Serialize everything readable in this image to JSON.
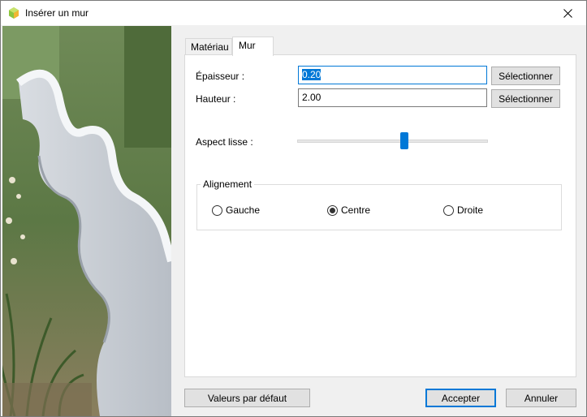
{
  "window": {
    "title": "Insérer un mur"
  },
  "tabs": [
    {
      "label": "Matériau"
    },
    {
      "label": "Mur"
    }
  ],
  "fields": {
    "epaisseur": {
      "label": "Épaisseur :",
      "value": "0.20",
      "button": "Sélectionner"
    },
    "hauteur": {
      "label": "Hauteur :",
      "value": "2.00",
      "button": "Sélectionner"
    }
  },
  "slider": {
    "label": "Aspect lisse :",
    "value_fraction": 0.56
  },
  "alignment": {
    "legend": "Alignement",
    "options": [
      {
        "label": "Gauche",
        "checked": false
      },
      {
        "label": "Centre",
        "checked": true
      },
      {
        "label": "Droite",
        "checked": false
      }
    ]
  },
  "buttons": {
    "defaults": "Valeurs par défaut",
    "accept": "Accepter",
    "cancel": "Annuler"
  },
  "colors": {
    "accent": "#0078d7",
    "app_icon": "#8cc63f"
  }
}
